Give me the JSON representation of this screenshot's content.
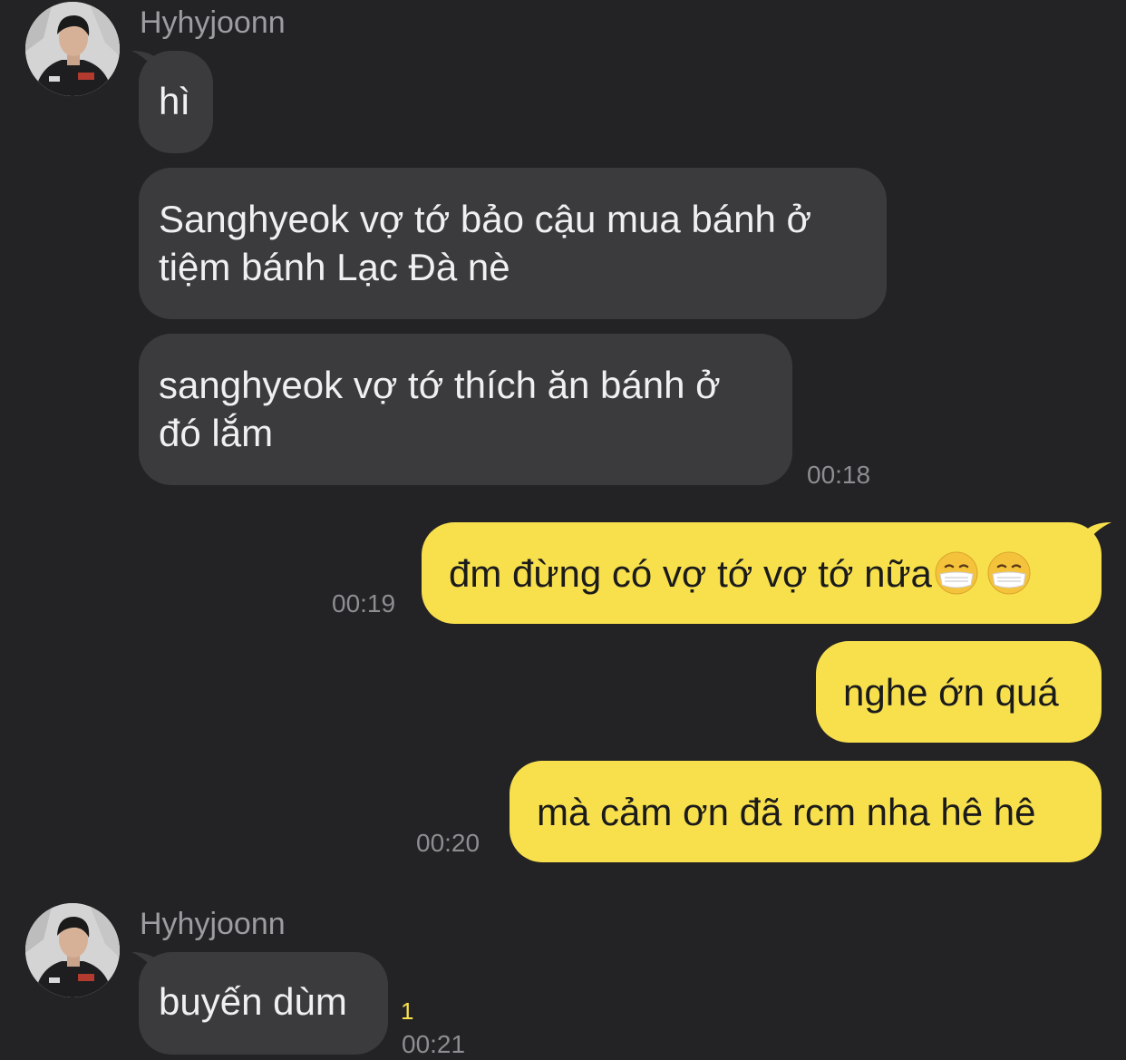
{
  "contact": {
    "name": "Hyhyjoonn",
    "avatar_icon": "profile-photo"
  },
  "messages": [
    {
      "dir": "in",
      "text": "hì"
    },
    {
      "dir": "in",
      "text": "Sanghyeok vợ tớ bảo cậu mua bánh ở tiệm bánh Lạc Đà nè",
      "line1": "Sanghyeok vợ tớ bảo cậu mua bánh ở",
      "line2": "tiệm bánh Lạc Đà nè"
    },
    {
      "dir": "in",
      "text": "sanghyeok vợ tớ thích ăn bánh ở đó lắm",
      "line1": "sanghyeok vợ tớ thích ăn bánh ở",
      "line2": "đó lắm",
      "time": "00:18"
    },
    {
      "dir": "out",
      "text": "đm đừng có vợ tớ vợ tớ nữa",
      "emoji": [
        "face-with-medical-mask",
        "face-with-medical-mask"
      ],
      "time": "00:19"
    },
    {
      "dir": "out",
      "text": "nghe ớn quá"
    },
    {
      "dir": "out",
      "text": "mà cảm ơn đã rcm nha hê hê",
      "time": "00:20"
    },
    {
      "dir": "in",
      "text": "buyến dùm",
      "time": "00:21",
      "unread_count": "1"
    }
  ],
  "colors": {
    "background": "#232325",
    "incoming_bubble": "#3b3b3d",
    "outgoing_bubble": "#f8e04d",
    "timestamp": "#8d8d92",
    "unread": "#f8e04d"
  }
}
